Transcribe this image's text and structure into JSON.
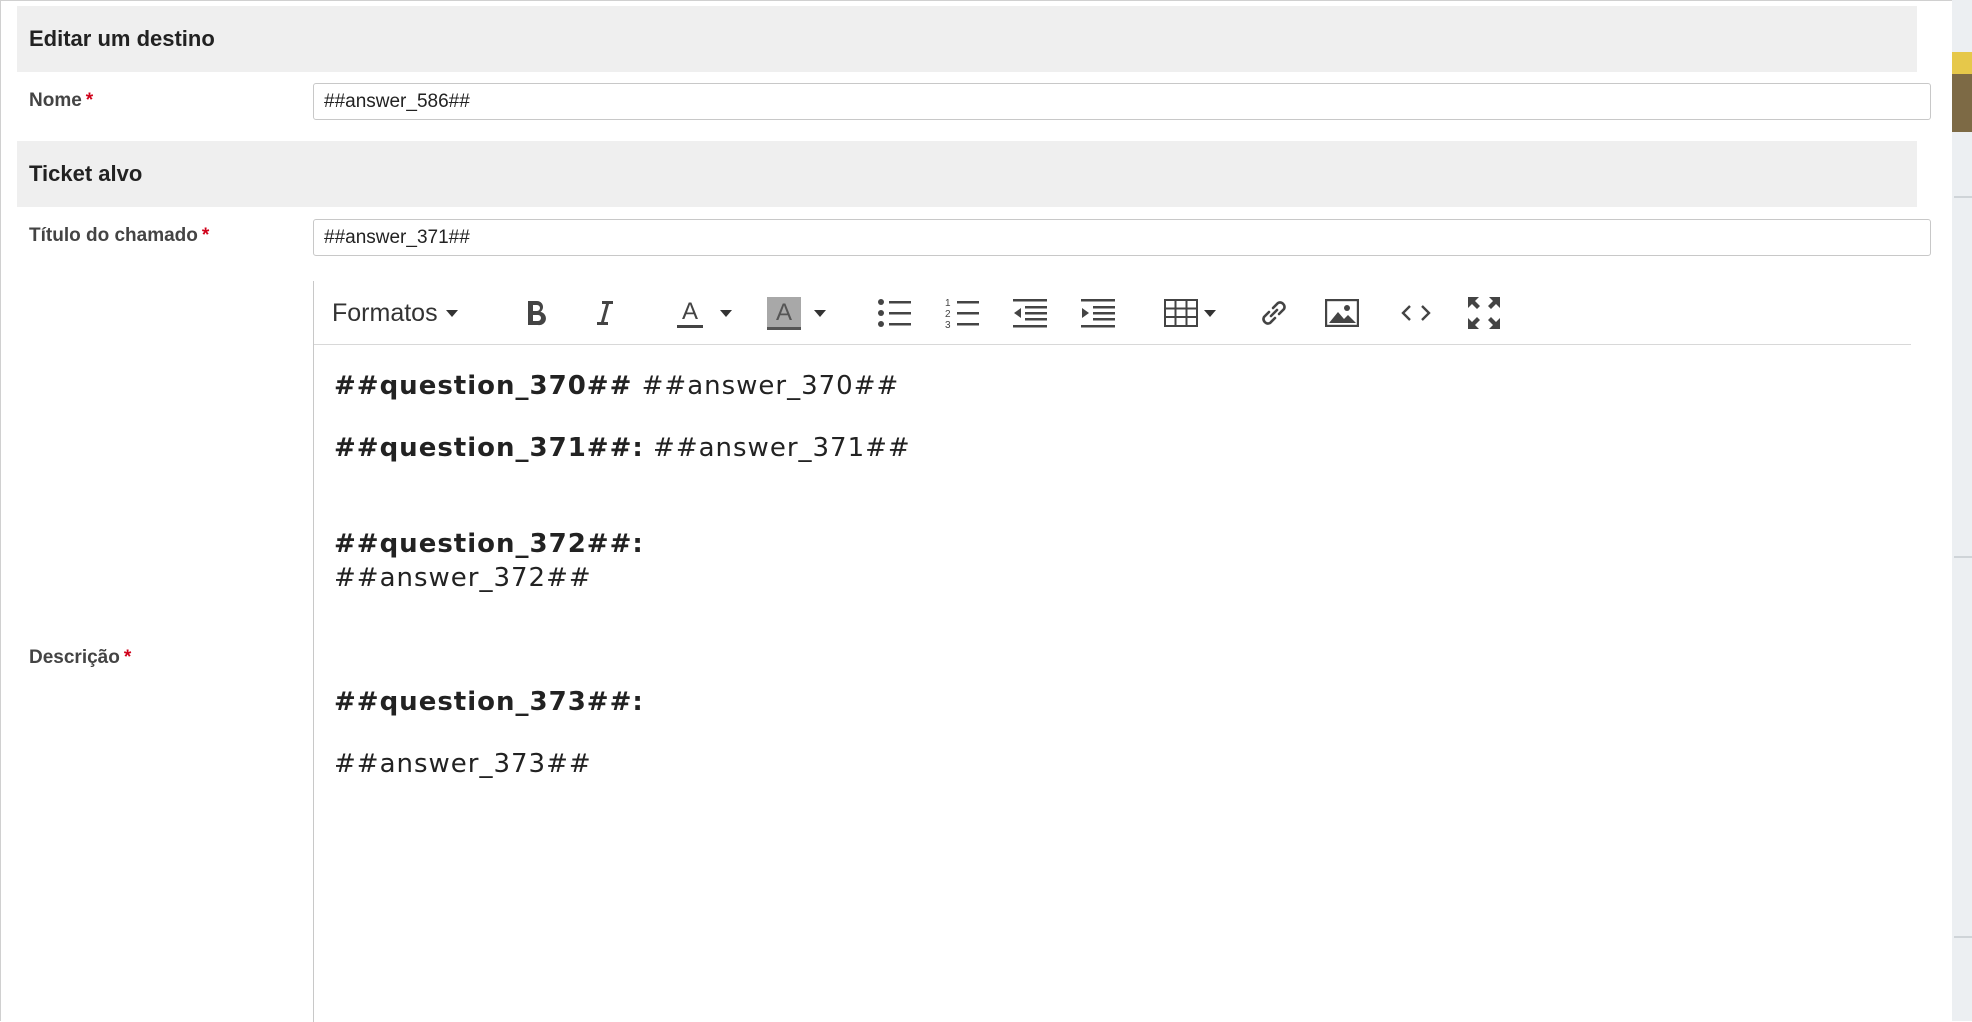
{
  "sections": {
    "edit_destination": "Editar um destino",
    "target_ticket": "Ticket alvo"
  },
  "fields": {
    "name": {
      "label": "Nome",
      "required_mark": "*",
      "value": "##answer_586##"
    },
    "ticket_title": {
      "label": "Título do chamado",
      "required_mark": "*",
      "value": "##answer_371##"
    },
    "description": {
      "label": "Descrição",
      "required_mark": "*"
    }
  },
  "editor": {
    "formats_label": "Formatos",
    "toolbar_icons": [
      "bold-icon",
      "italic-icon",
      "text-color-icon",
      "background-color-icon",
      "bullet-list-icon",
      "numbered-list-icon",
      "outdent-icon",
      "indent-icon",
      "table-icon",
      "link-icon",
      "image-icon",
      "source-code-icon",
      "fullscreen-icon"
    ],
    "content": {
      "q370": "##question_370##",
      "a370": "##answer_370##",
      "q371": "##question_371##:",
      "a371": "##answer_371##",
      "q372": "##question_372##:",
      "a372": "##answer_372##",
      "q373": "##question_373##:",
      "a373": "##answer_373##"
    }
  },
  "colors": {
    "section_bg": "#efefef",
    "required": "#d0021b",
    "scroll_gold": "#e6c84a",
    "scroll_brown": "#7d6a45"
  }
}
